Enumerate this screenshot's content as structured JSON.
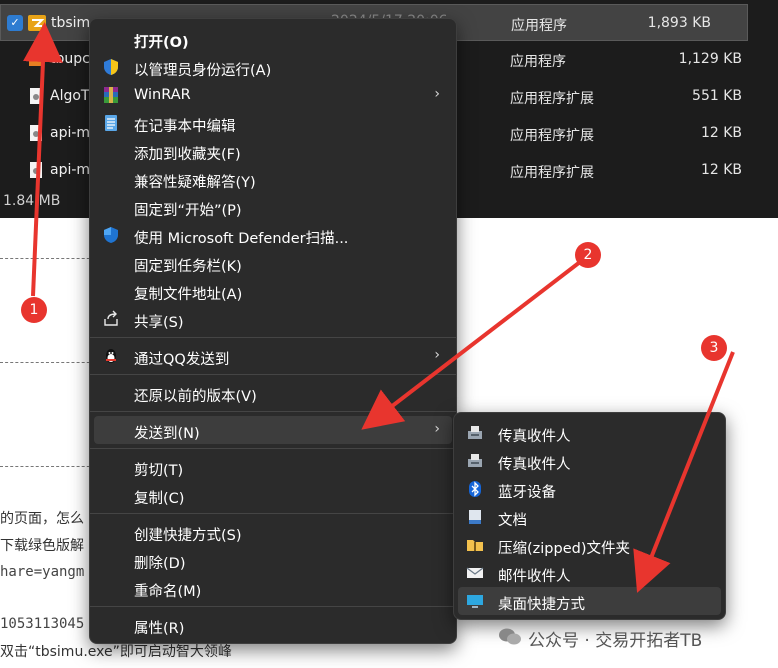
{
  "files": [
    {
      "name": "tbsim",
      "date": "2024/5/17 20:06",
      "type": "应用程序",
      "size": "1,893 KB",
      "icon": "app-exe-icon",
      "selected": true
    },
    {
      "name": "tbupc",
      "type": "应用程序",
      "size": "1,129 KB",
      "icon": "installer-icon"
    },
    {
      "name": "AlgoT",
      "type": "应用程序扩展",
      "size": "551 KB",
      "icon": "dll-icon"
    },
    {
      "name": "api-m",
      "type": "应用程序扩展",
      "size": "12 KB",
      "icon": "dll-icon"
    },
    {
      "name": "api-m",
      "type": "应用程序扩展",
      "size": "12 KB",
      "icon": "dll-icon"
    }
  ],
  "status": {
    "size_text": "1.84 MB"
  },
  "article": {
    "line1": "的页面，怎么",
    "line2": "下载绿色版解",
    "line3": "hare=yangm",
    "line4": "1053113045",
    "line5": "双击“tbsimu.exe”即可启动智大领峰"
  },
  "menu": {
    "items": [
      {
        "label": "打开(O)",
        "bold": true
      },
      {
        "label": "以管理员身份运行(A)",
        "icon": "uac-shield-icon"
      },
      {
        "label": "WinRAR",
        "icon": "winrar-icon",
        "submenu": true
      },
      {
        "label": "在记事本中编辑",
        "icon": "notepad-icon"
      },
      {
        "label": "添加到收藏夹(F)"
      },
      {
        "label": "兼容性疑难解答(Y)"
      },
      {
        "label": "固定到“开始”(P)"
      },
      {
        "label": "使用 Microsoft Defender扫描...",
        "icon": "defender-shield-icon"
      },
      {
        "label": "固定到任务栏(K)"
      },
      {
        "label": "复制文件地址(A)"
      },
      {
        "label": "共享(S)",
        "icon": "share-icon"
      },
      {
        "label": "通过QQ发送到",
        "icon": "qq-icon",
        "submenu": true
      },
      {
        "label": "还原以前的版本(V)"
      },
      {
        "label": "发送到(N)",
        "submenu": true
      },
      {
        "label": "剪切(T)"
      },
      {
        "label": "复制(C)"
      },
      {
        "label": "创建快捷方式(S)"
      },
      {
        "label": "删除(D)"
      },
      {
        "label": "重命名(M)"
      },
      {
        "label": "属性(R)"
      }
    ]
  },
  "submenu": {
    "items": [
      {
        "label": "传真收件人",
        "icon": "fax-icon"
      },
      {
        "label": "传真收件人",
        "icon": "fax-icon"
      },
      {
        "label": "蓝牙设备",
        "icon": "bluetooth-icon"
      },
      {
        "label": "文档",
        "icon": "documents-icon"
      },
      {
        "label": "压缩(zipped)文件夹",
        "icon": "zip-folder-icon"
      },
      {
        "label": "邮件收件人",
        "icon": "mail-icon"
      },
      {
        "label": "桌面快捷方式",
        "icon": "desktop-icon"
      }
    ]
  },
  "annotations": {
    "badge1": "1",
    "badge2": "2",
    "badge3": "3",
    "accent": "#e8352e"
  },
  "watermark": "公众号 · 交易开拓者TB"
}
